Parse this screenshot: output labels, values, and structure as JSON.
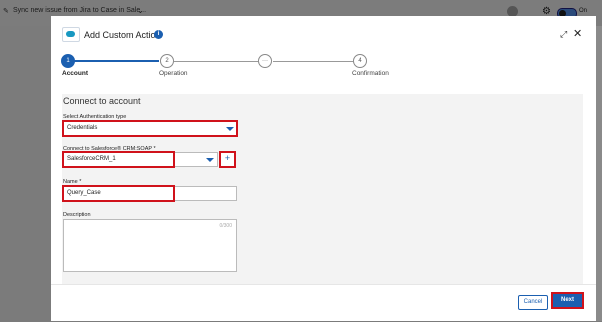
{
  "app": {
    "breadcrumb_title": "Sync new issue from Jira to Case in Sale...",
    "toggle_label": "On"
  },
  "modal": {
    "title": "Add Custom Action",
    "info_icon": "info-icon",
    "expand_icon": "expand-icon",
    "close_icon": "close-icon"
  },
  "stepper": {
    "steps": [
      {
        "number": "1",
        "label": "Account",
        "active": true
      },
      {
        "number": "2",
        "label": "Operation",
        "active": false
      },
      {
        "number": "···",
        "label": "",
        "active": false
      },
      {
        "number": "4",
        "label": "Confirmation",
        "active": false
      }
    ]
  },
  "form": {
    "section_title": "Connect to account",
    "auth_type_label": "Select Authentication type",
    "auth_type_value": "Credentials",
    "connection_label": "Connect to Salesforce® CRM:SOAP *",
    "connection_value": "SalesforceCRM_1",
    "add_connection_symbol": "+",
    "name_label": "Name *",
    "name_value": "Query_Case",
    "description_label": "Description",
    "description_value": "",
    "description_counter": "0/300"
  },
  "footer": {
    "cancel_label": "Cancel",
    "next_label": "Next"
  },
  "colors": {
    "accent": "#1b5fb0",
    "highlight": "#d0121b"
  }
}
